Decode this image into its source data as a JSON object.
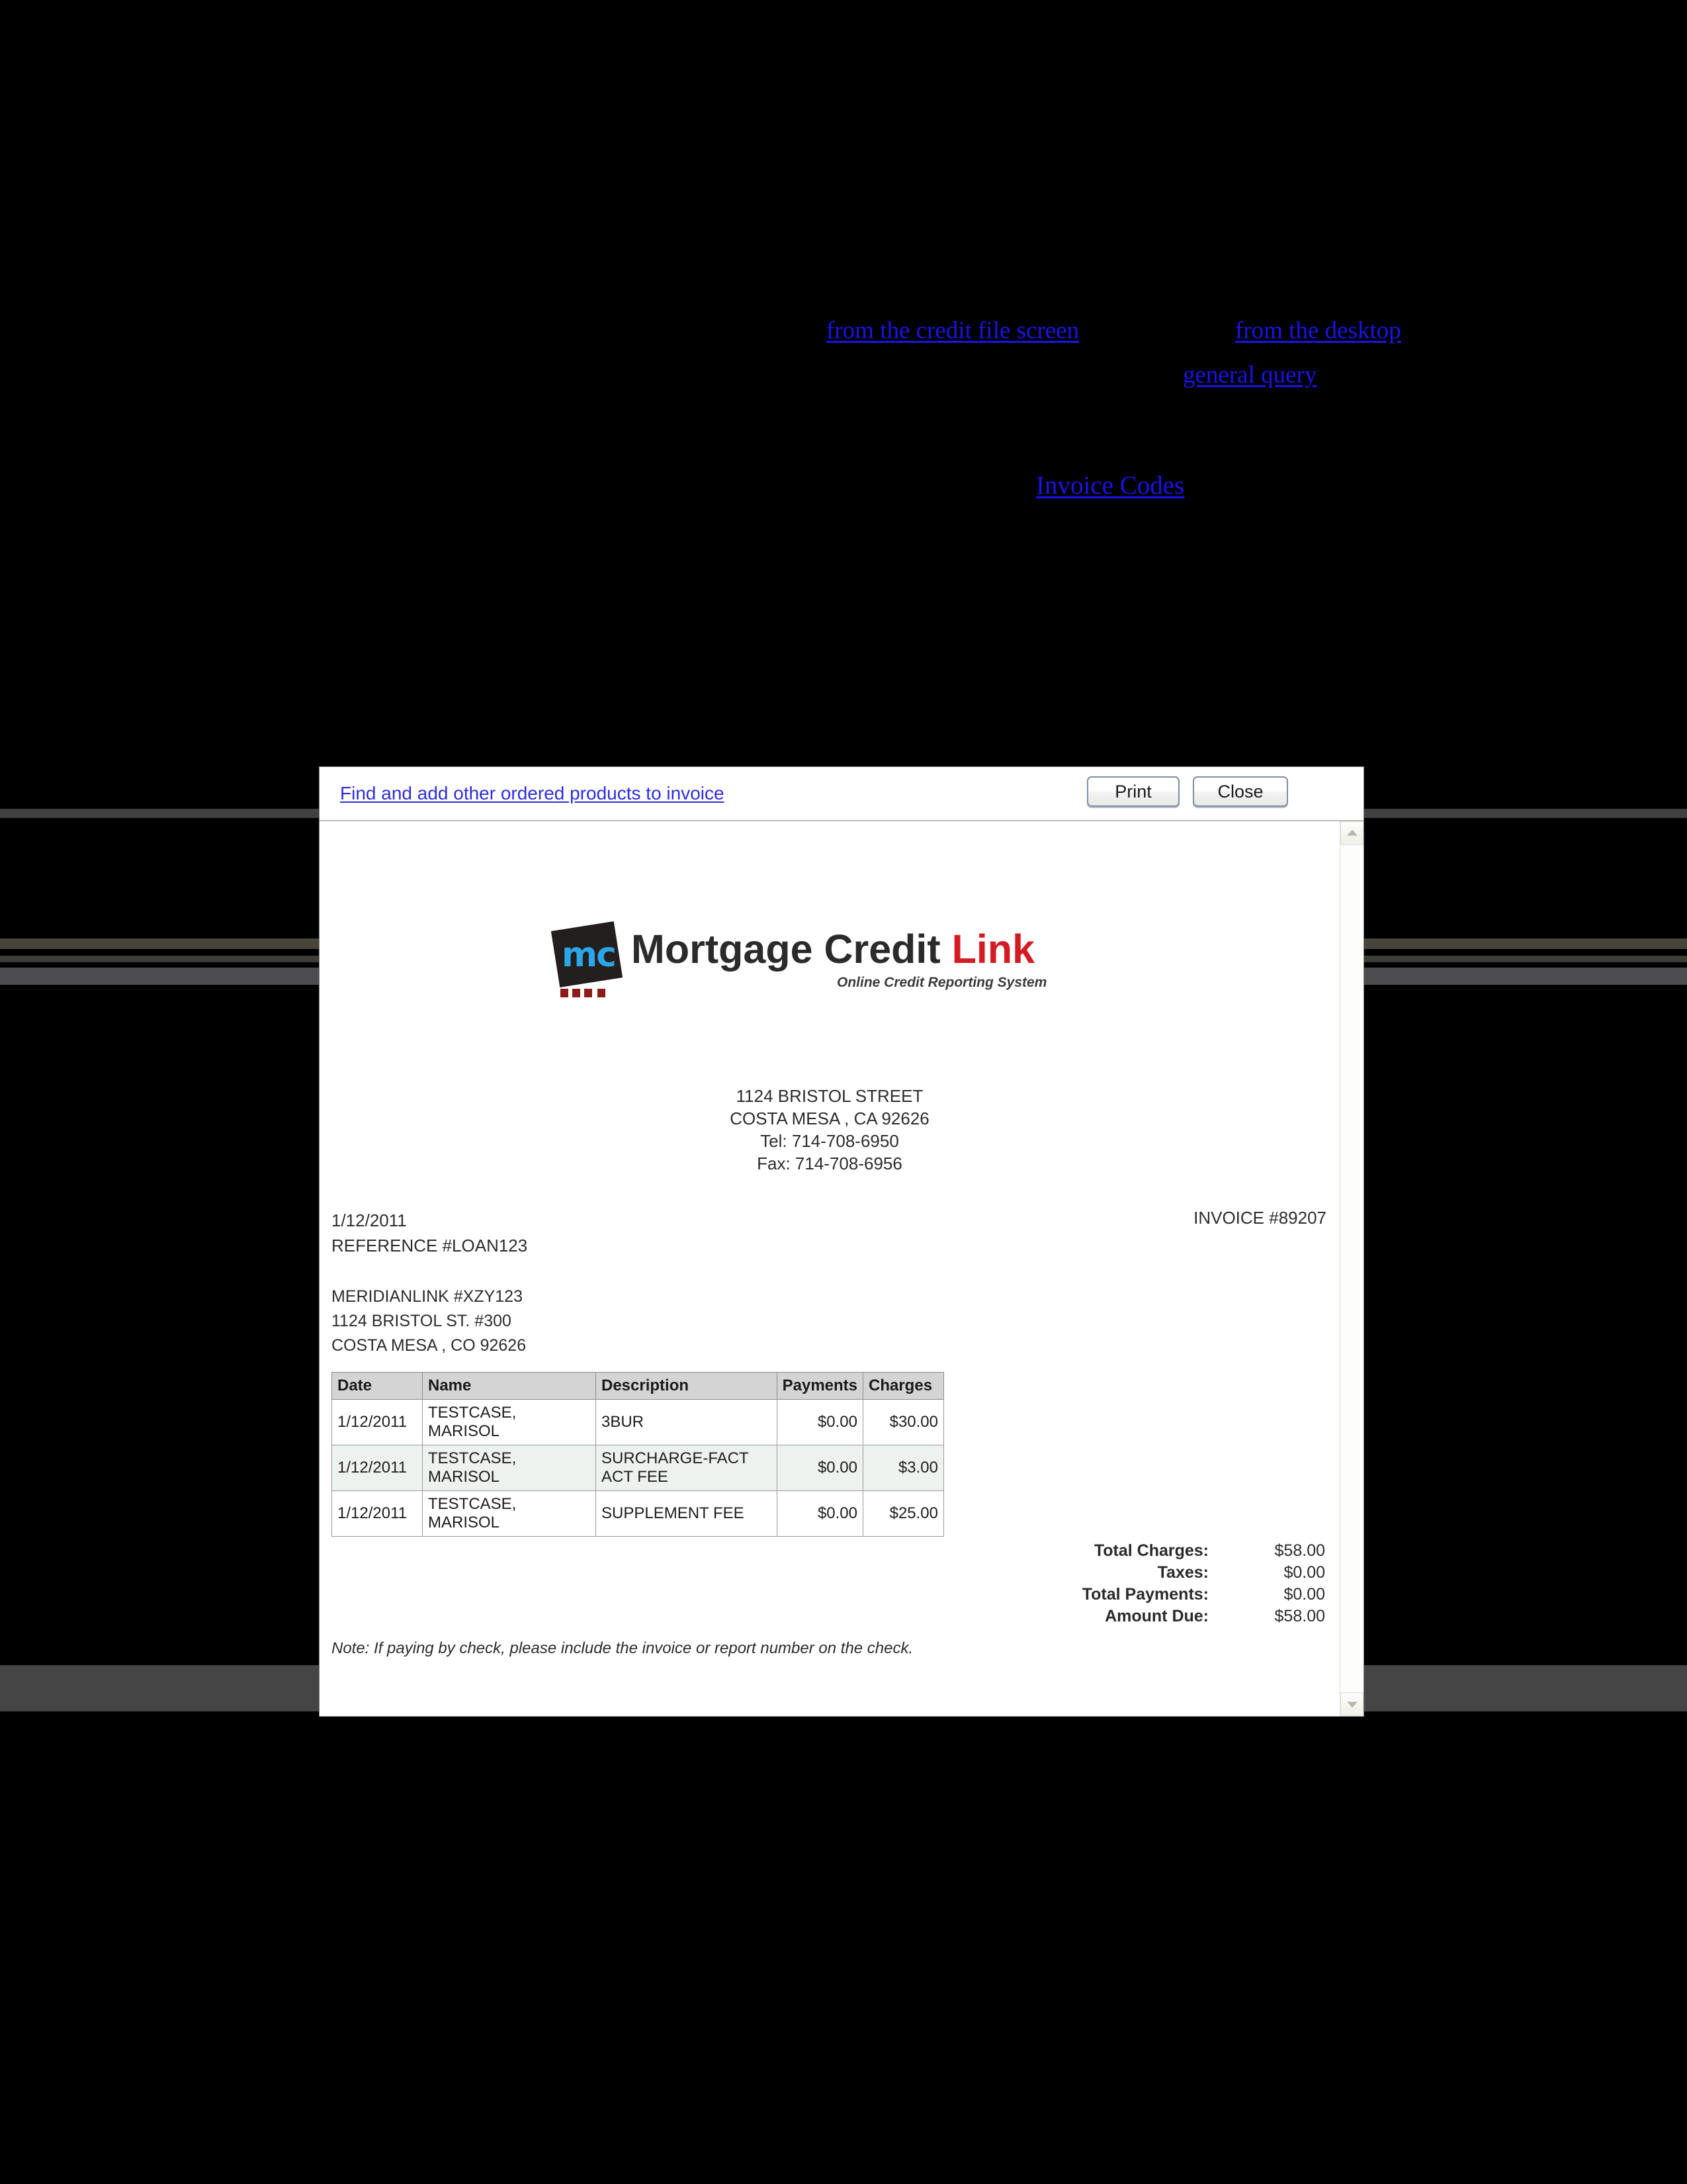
{
  "page": {
    "background_color": "#000000"
  },
  "top_links": {
    "credit_file": "from the credit file screen",
    "desktop": "from the desktop",
    "general_query": "general query",
    "invoice_codes": "Invoice Codes",
    "link_color": "#1a13e8"
  },
  "dialog": {
    "toolbar": {
      "find_products_link": "Find and add other ordered products to invoice",
      "print_label": "Print",
      "close_label": "Close"
    },
    "scrollbar": {
      "up_icon": "chevron-up-icon",
      "down_icon": "chevron-down-icon"
    }
  },
  "invoice": {
    "logo": {
      "mark_text": "mc",
      "word_primary": "Mortgage Credit ",
      "word_accent": "Link",
      "tagline": "Online Credit Reporting System",
      "accent_color": "#d41b22",
      "mark_color": "#2ba6e8"
    },
    "company_address": {
      "street": "1124 BRISTOL STREET",
      "city_state_zip": "COSTA MESA , CA 92626",
      "tel": "Tel: 714-708-6950",
      "fax": "Fax: 714-708-6956"
    },
    "meta": {
      "date": "1/12/2011",
      "reference": "REFERENCE #LOAN123",
      "invoice_number": "INVOICE #89207"
    },
    "bill_to": {
      "line1": "MERIDIANLINK #XZY123",
      "line2": "1124 BRISTOL ST. #300",
      "line3": "COSTA MESA , CO 92626"
    },
    "table": {
      "columns": [
        "Date",
        "Name",
        "Description",
        "Payments",
        "Charges"
      ],
      "rows": [
        {
          "date": "1/12/2011",
          "name": "TESTCASE, MARISOL",
          "description": "3BUR",
          "payments": "$0.00",
          "charges": "$30.00"
        },
        {
          "date": "1/12/2011",
          "name": "TESTCASE, MARISOL",
          "description": "SURCHARGE-FACT ACT FEE",
          "payments": "$0.00",
          "charges": "$3.00"
        },
        {
          "date": "1/12/2011",
          "name": "TESTCASE, MARISOL",
          "description": "SUPPLEMENT FEE",
          "payments": "$0.00",
          "charges": "$25.00"
        }
      ]
    },
    "totals": [
      {
        "label": "Total Charges:",
        "value": "$58.00"
      },
      {
        "label": "Taxes:",
        "value": "$0.00"
      },
      {
        "label": "Total Payments:",
        "value": "$0.00"
      },
      {
        "label": "Amount Due:",
        "value": "$58.00"
      }
    ],
    "note": "Note: If paying by check, please include the invoice or report number on the check."
  }
}
